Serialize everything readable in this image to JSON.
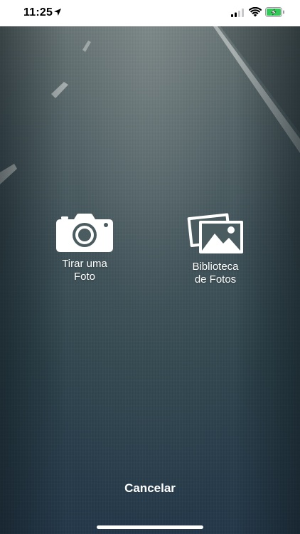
{
  "status_bar": {
    "time": "11:25",
    "icons": [
      "location-arrow-icon",
      "cellular-signal-icon",
      "wifi-icon",
      "battery-charging-icon"
    ],
    "battery_color": "#34c759"
  },
  "actions": {
    "take_photo": {
      "label_line1": "Tirar uma",
      "label_line2": "Foto",
      "icon": "camera-icon"
    },
    "photo_library": {
      "label_line1": "Biblioteca",
      "label_line2": "de Fotos",
      "icon": "photo-library-icon"
    }
  },
  "cancel_label": "Cancelar",
  "colors": {
    "overlay_text": "#ffffff",
    "status_bar_bg": "#ffffff"
  }
}
